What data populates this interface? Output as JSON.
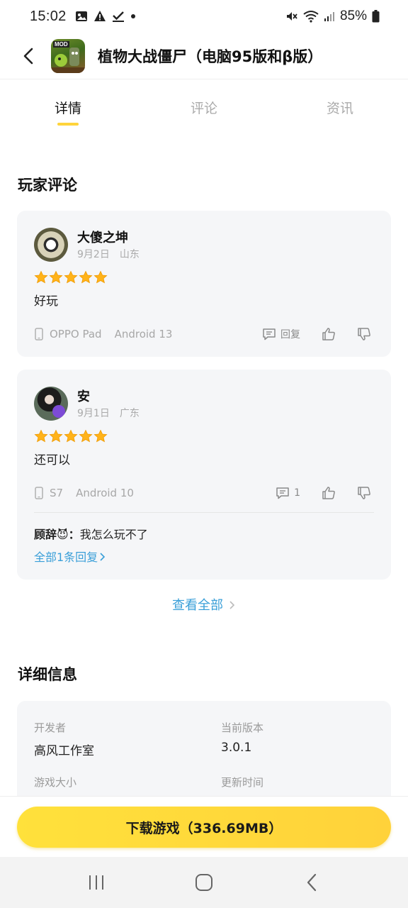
{
  "status_bar": {
    "time": "15:02",
    "battery": "85%"
  },
  "header": {
    "title": "植物大战僵尸（电脑95版和β版）",
    "app_icon_badge": "MOD"
  },
  "tabs": [
    {
      "label": "详情",
      "active": true
    },
    {
      "label": "评论",
      "active": false
    },
    {
      "label": "资讯",
      "active": false
    }
  ],
  "player_reviews": {
    "title": "玩家评论",
    "reviews": [
      {
        "username": "大傻之坤",
        "date": "9月2日",
        "location": "山东",
        "rating": 5,
        "content": "好玩",
        "device": "OPPO Pad",
        "os": "Android 13",
        "reply_label": "回复"
      },
      {
        "username": "安",
        "date": "9月1日",
        "location": "广东",
        "rating": 5,
        "content": "还可以",
        "device": "S7",
        "os": "Android 10",
        "reply_count": "1",
        "reply_preview": {
          "name": "顾辞😈：",
          "text": "我怎么玩不了"
        },
        "all_replies_link": "全部1条回复"
      }
    ],
    "view_all": "查看全部"
  },
  "detail_info": {
    "title": "详细信息",
    "fields": [
      {
        "label": "开发者",
        "value": "高风工作室"
      },
      {
        "label": "当前版本",
        "value": "3.0.1"
      },
      {
        "label": "游戏大小",
        "value": ""
      },
      {
        "label": "更新时间",
        "value": ""
      }
    ]
  },
  "download_button": "下载游戏（336.69MB）",
  "colors": {
    "accent_yellow": "#ffd43b",
    "link_blue": "#3a9fd8",
    "star": "#ffb31a",
    "card_bg": "#f5f6f8"
  }
}
